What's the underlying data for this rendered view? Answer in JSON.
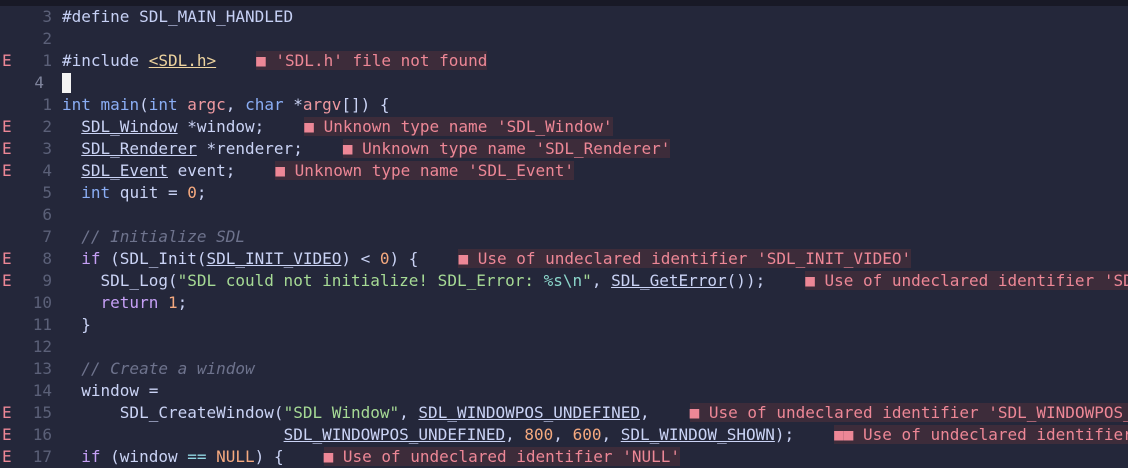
{
  "editor": {
    "lines": [
      {
        "sign": "",
        "num": "3",
        "tokens": [
          {
            "t": "#define SDL_MAIN_HANDLED",
            "c": "pp"
          }
        ]
      },
      {
        "sign": "",
        "num": "2",
        "tokens": []
      },
      {
        "sign": "E",
        "num": "1",
        "tokens": [
          {
            "t": "#include ",
            "c": "pp"
          },
          {
            "t": "<SDL.h>",
            "c": "hdr"
          }
        ],
        "diag": "■ 'SDL.h' file not found"
      },
      {
        "sign": "",
        "num": "4",
        "current": true,
        "cursor": true,
        "tokens": []
      },
      {
        "sign": "",
        "num": "1",
        "tokens": [
          {
            "t": "int",
            "c": "kw"
          },
          {
            "t": " "
          },
          {
            "t": "main",
            "c": "fn"
          },
          {
            "t": "("
          },
          {
            "t": "int",
            "c": "kw"
          },
          {
            "t": " "
          },
          {
            "t": "argc",
            "c": "param"
          },
          {
            "t": ", "
          },
          {
            "t": "char",
            "c": "kw"
          },
          {
            "t": " *"
          },
          {
            "t": "argv",
            "c": "param"
          },
          {
            "t": "[]) {"
          }
        ]
      },
      {
        "sign": "E",
        "num": "2",
        "tokens": [
          {
            "t": "  "
          },
          {
            "t": "SDL_Window",
            "c": "ul"
          },
          {
            "t": " *window;"
          }
        ],
        "diag": "■ Unknown type name 'SDL_Window'"
      },
      {
        "sign": "E",
        "num": "3",
        "tokens": [
          {
            "t": "  "
          },
          {
            "t": "SDL_Renderer",
            "c": "ul"
          },
          {
            "t": " *renderer;"
          }
        ],
        "diag": "■ Unknown type name 'SDL_Renderer'"
      },
      {
        "sign": "E",
        "num": "4",
        "tokens": [
          {
            "t": "  "
          },
          {
            "t": "SDL_Event",
            "c": "ul"
          },
          {
            "t": " event;"
          }
        ],
        "diag": "■ Unknown type name 'SDL_Event'"
      },
      {
        "sign": "",
        "num": "5",
        "tokens": [
          {
            "t": "  "
          },
          {
            "t": "int",
            "c": "kw"
          },
          {
            "t": " quit = "
          },
          {
            "t": "0",
            "c": "num"
          },
          {
            "t": ";"
          }
        ]
      },
      {
        "sign": "",
        "num": "6",
        "tokens": []
      },
      {
        "sign": "",
        "num": "7",
        "tokens": [
          {
            "t": "  "
          },
          {
            "t": "// Initialize SDL",
            "c": "com"
          }
        ]
      },
      {
        "sign": "E",
        "num": "8",
        "tokens": [
          {
            "t": "  "
          },
          {
            "t": "if",
            "c": "ctrl"
          },
          {
            "t": " (SDL_Init("
          },
          {
            "t": "SDL_INIT_VIDEO",
            "c": "ul"
          },
          {
            "t": ") < "
          },
          {
            "t": "0",
            "c": "num"
          },
          {
            "t": ") {"
          }
        ],
        "diag": "■ Use of undeclared identifier 'SDL_INIT_VIDEO'"
      },
      {
        "sign": "E",
        "num": "9",
        "tokens": [
          {
            "t": "    SDL_Log("
          },
          {
            "t": "\"SDL could not initialize! SDL_Error: ",
            "c": "str"
          },
          {
            "t": "%s\\n",
            "c": "esc"
          },
          {
            "t": "\"",
            "c": "str"
          },
          {
            "t": ", "
          },
          {
            "t": "SDL_GetError",
            "c": "ul"
          },
          {
            "t": "());"
          }
        ],
        "diag": "■ Use of undeclared identifier 'SDL_GetError'"
      },
      {
        "sign": "",
        "num": "10",
        "tokens": [
          {
            "t": "    "
          },
          {
            "t": "return",
            "c": "ctrl"
          },
          {
            "t": " "
          },
          {
            "t": "1",
            "c": "num"
          },
          {
            "t": ";"
          }
        ]
      },
      {
        "sign": "",
        "num": "11",
        "tokens": [
          {
            "t": "  }"
          }
        ]
      },
      {
        "sign": "",
        "num": "12",
        "tokens": []
      },
      {
        "sign": "",
        "num": "13",
        "tokens": [
          {
            "t": "  "
          },
          {
            "t": "// Create a window",
            "c": "com"
          }
        ]
      },
      {
        "sign": "",
        "num": "14",
        "tokens": [
          {
            "t": "  window ="
          }
        ]
      },
      {
        "sign": "E",
        "num": "15",
        "tokens": [
          {
            "t": "      SDL_CreateWindow("
          },
          {
            "t": "\"SDL Window\"",
            "c": "str"
          },
          {
            "t": ", "
          },
          {
            "t": "SDL_WINDOWPOS_UNDEFINED",
            "c": "ul"
          },
          {
            "t": ","
          }
        ],
        "diag": "■ Use of undeclared identifier 'SDL_WINDOWPOS_UNDEFINED'"
      },
      {
        "sign": "E",
        "num": "16",
        "tokens": [
          {
            "t": "                       "
          },
          {
            "t": "SDL_WINDOWPOS_UNDEFINED",
            "c": "ul"
          },
          {
            "t": ", "
          },
          {
            "t": "800",
            "c": "num"
          },
          {
            "t": ", "
          },
          {
            "t": "600",
            "c": "num"
          },
          {
            "t": ", "
          },
          {
            "t": "SDL_WINDOW_SHOWN",
            "c": "ul"
          },
          {
            "t": ");"
          }
        ],
        "diag": "■■ Use of undeclared identifier 'SDL_WINDOW_SHOWN'"
      },
      {
        "sign": "E",
        "num": "17",
        "tokens": [
          {
            "t": "  "
          },
          {
            "t": "if",
            "c": "ctrl"
          },
          {
            "t": " (window "
          },
          {
            "t": "==",
            "c": "op"
          },
          {
            "t": " "
          },
          {
            "t": "NULL",
            "c": "num"
          },
          {
            "t": ") {"
          }
        ],
        "diag": "■ Use of undeclared identifier 'NULL'"
      }
    ]
  },
  "colors": {
    "background": "#24273a",
    "error": "#ed8796",
    "keyword": "#8aadf4",
    "string": "#a6da95",
    "number": "#f5a97f",
    "comment": "#6e738d"
  }
}
